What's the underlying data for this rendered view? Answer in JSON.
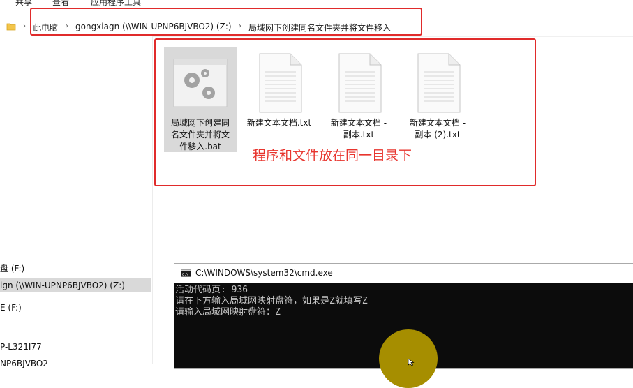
{
  "ribbon": {
    "tabs": [
      "共享",
      "查看",
      "应用程序工具"
    ]
  },
  "address": {
    "crumbs": [
      "此电脑",
      "gongxiagn (\\\\WIN-UPNP6BJVBO2) (Z:)",
      "局域网下创建同名文件夹并将文件移入"
    ],
    "separator": "›"
  },
  "nav": {
    "items": [
      {
        "label": "盘 (F:)",
        "selected": false
      },
      {
        "label": "ign (\\\\WIN-UPNP6BJVBO2) (Z:)",
        "selected": true
      },
      {
        "label": "E (F:)",
        "selected": false
      },
      {
        "label": "P-L321I77",
        "selected": false
      },
      {
        "label": "NP6BJVBO2",
        "selected": false
      }
    ]
  },
  "files": [
    {
      "name": "局域网下创建同名文件夹并将文件移入.bat",
      "lines": [
        "局域网下创建同",
        "名文件夹并将文",
        "件移入.bat"
      ],
      "type": "bat",
      "selected": true
    },
    {
      "name": "新建文本文档.txt",
      "lines": [
        "新建文本文档.txt"
      ],
      "type": "txt",
      "selected": false
    },
    {
      "name": "新建文本文档 - 副本.txt",
      "lines": [
        "新建文本文档 -",
        "副本.txt"
      ],
      "type": "txt",
      "selected": false
    },
    {
      "name": "新建文本文档 - 副本 (2).txt",
      "lines": [
        "新建文本文档 -",
        "副本 (2).txt"
      ],
      "type": "txt",
      "selected": false
    }
  ],
  "annotation": {
    "note": "程序和文件放在同一目录下",
    "color": "#e02b2b"
  },
  "cmd": {
    "title": "C:\\WINDOWS\\system32\\cmd.exe",
    "lines": [
      "活动代码页: 936",
      "请在下方输入局域网映射盘符，如果是Z就填写Z",
      "请输入局域网映射盘符：Z"
    ]
  },
  "colors": {
    "selection": "#d9d9d9",
    "highlight": "#a68e00",
    "console_bg": "#0c0c0c"
  }
}
